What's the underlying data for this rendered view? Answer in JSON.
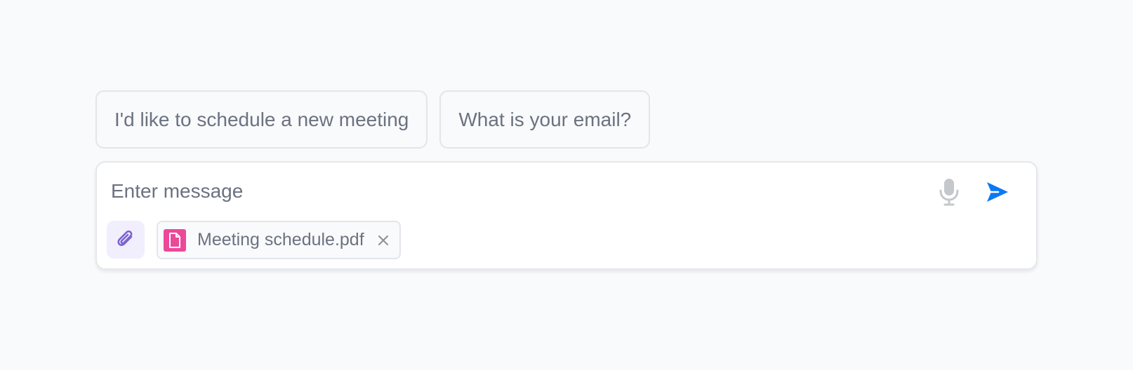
{
  "suggestions": [
    {
      "label": "I'd like to schedule a new meeting"
    },
    {
      "label": "What is your email?"
    }
  ],
  "composer": {
    "placeholder": "Enter message",
    "value": "",
    "mic_icon": "microphone-icon",
    "send_icon": "send-icon",
    "attach_icon": "paperclip-icon"
  },
  "attachment": {
    "file_name": "Meeting schedule.pdf",
    "file_icon": "document-icon",
    "remove_icon": "close-icon"
  },
  "colors": {
    "background": "#f9fafc",
    "send_accent": "#0b79f3",
    "attach_accent": "#7c63d4",
    "attach_bg": "#f1effd",
    "file_icon_bg": "#ec4899",
    "muted_icon": "#c4c7cc"
  }
}
